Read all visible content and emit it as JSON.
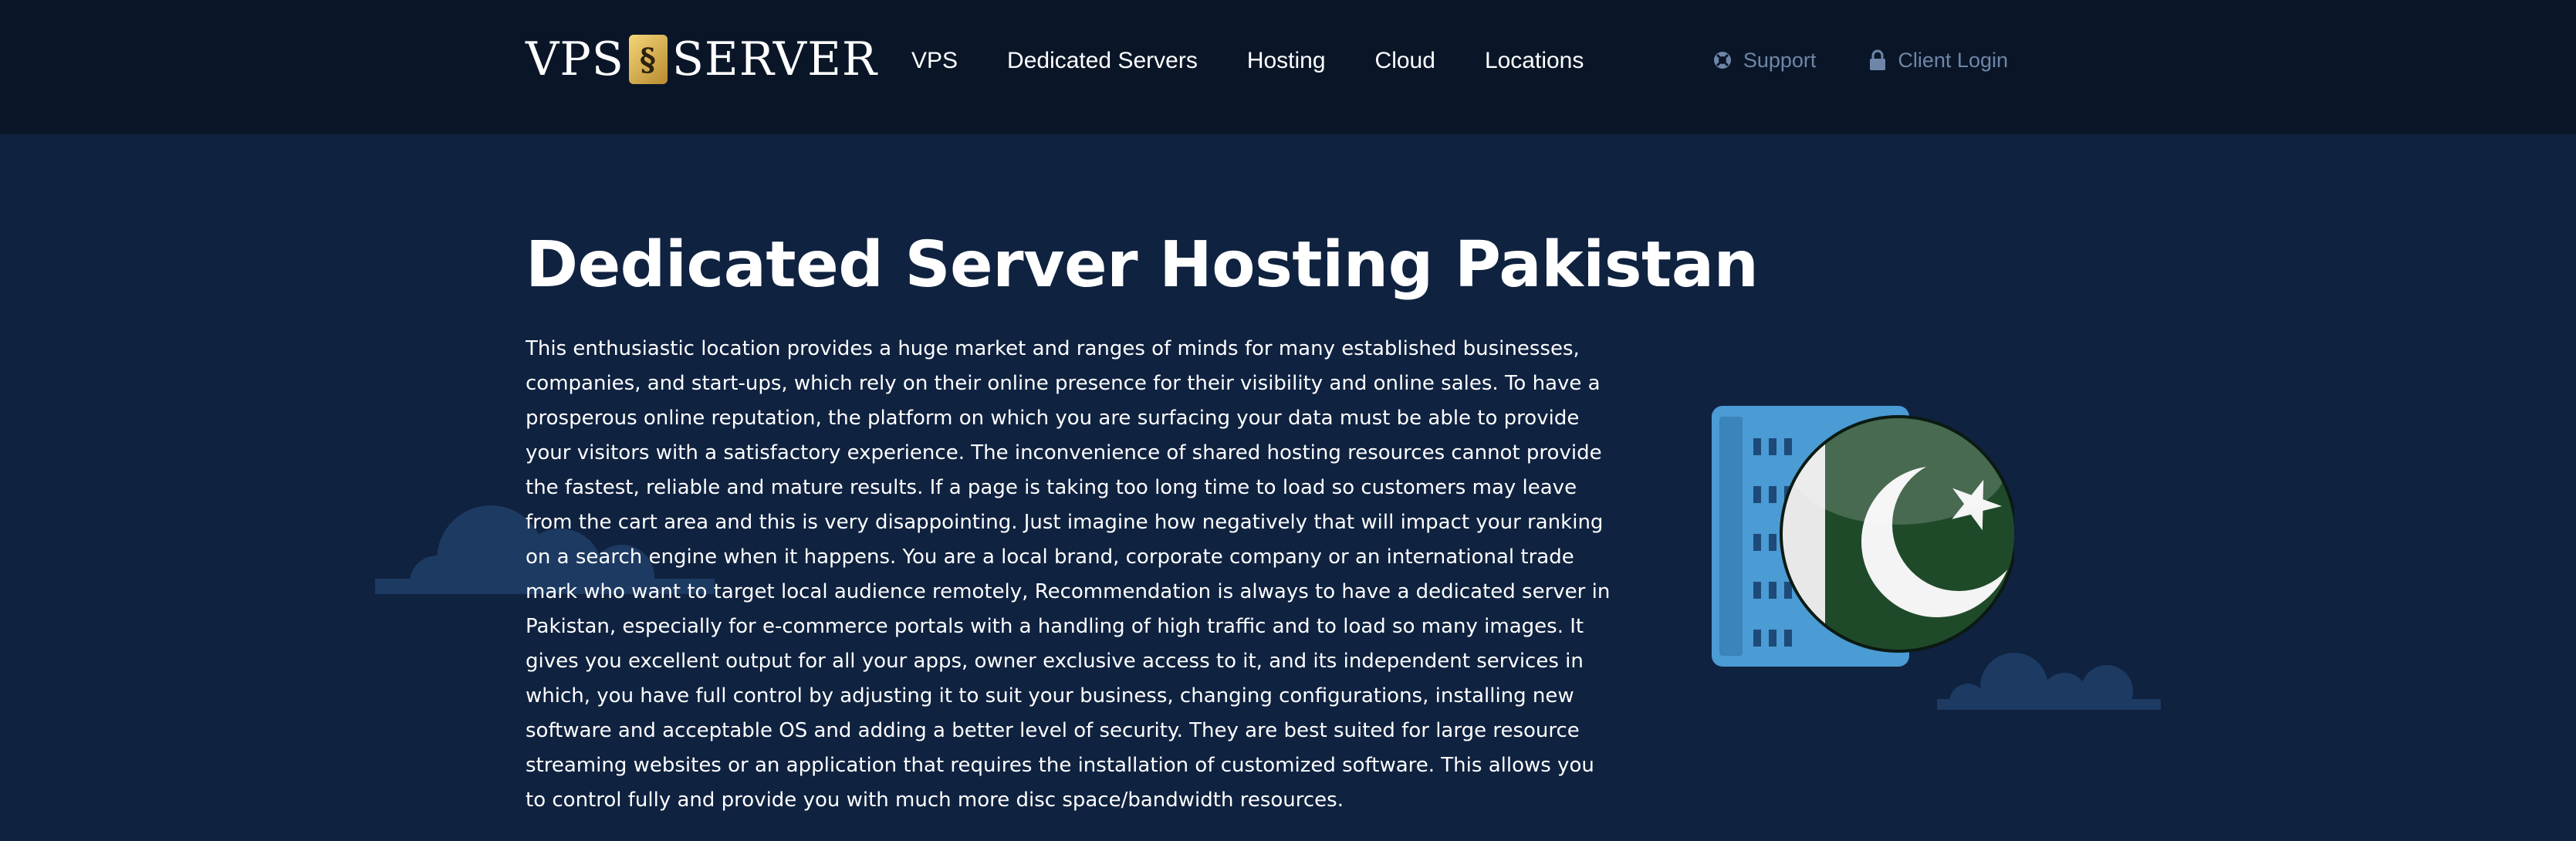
{
  "header": {
    "logo": {
      "left_text": "VPS",
      "chip_text": "§",
      "right_text": "SERVER"
    },
    "nav": [
      {
        "label": "VPS"
      },
      {
        "label": "Dedicated Servers"
      },
      {
        "label": "Hosting"
      },
      {
        "label": "Cloud"
      },
      {
        "label": "Locations"
      }
    ],
    "utility": {
      "support": {
        "label": "Support",
        "icon": "lifebuoy-icon"
      },
      "login": {
        "label": "Client Login",
        "icon": "lock-icon"
      }
    }
  },
  "hero": {
    "title": "Dedicated Server Hosting Pakistan",
    "body": "This enthusiastic location provides a huge market and ranges of minds for many established businesses, companies, and start-ups, which rely on their online presence for their visibility and online sales. To have a prosperous online reputation, the platform on which you are surfacing your data must be able to provide your visitors with a satisfactory experience. The inconvenience of shared hosting resources cannot provide the fastest, reliable and mature results. If a page is taking too long time to load so customers may leave from the cart area and this is very disappointing. Just imagine how negatively that will impact your ranking on a search engine when it happens. You are a local brand, corporate company or an international trade mark who want to target local audience remotely, Recommendation is always to have a dedicated server in Pakistan, especially for e-commerce portals with a handling of high traffic and to load so many images. It gives you excellent output for all your apps, owner exclusive access to it, and its independent services in which, you have full control by adjusting it to suit your business, changing configurations, installing new software and acceptable OS and adding a better level of security. They are best suited for large resource streaming websites or an application that requires the installation of customized software. This allows you to control fully and provide you with much more disc space/bandwidth resources.",
    "illustration": {
      "server_icon": "server-rack-icon",
      "flag_icon": "pakistan-flag-icon"
    }
  },
  "colors": {
    "page_bg": "#0f2240",
    "header_bg": "#0a1628",
    "utility_text": "#6f86a8",
    "server_blue": "#4b9bd4",
    "flag_green": "#1f4a2a"
  }
}
